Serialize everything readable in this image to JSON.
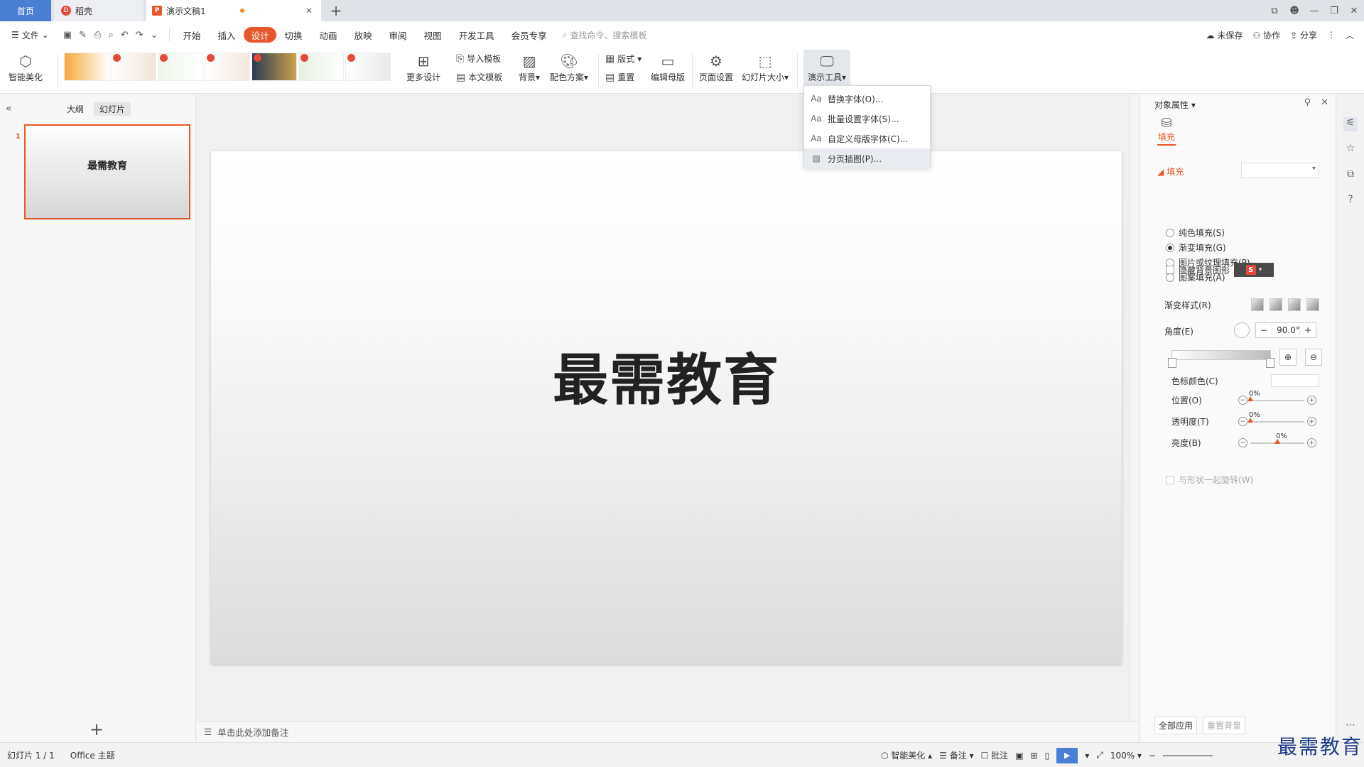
{
  "tabs": {
    "home": "首页",
    "daoke": "稻壳",
    "doc": "演示文稿1"
  },
  "menu": {
    "file": "文件",
    "tabs": [
      "开始",
      "插入",
      "设计",
      "切换",
      "动画",
      "放映",
      "审阅",
      "视图",
      "开发工具",
      "会员专享"
    ],
    "active_tab": "设计",
    "search_placeholder": "查找命令、搜索模板",
    "unsaved": "未保存",
    "collab": "协作",
    "share": "分享"
  },
  "ribbon": {
    "smart_beautify": "智能美化",
    "more_design": "更多设计",
    "import_template": "导入模板",
    "this_template": "本文模板",
    "background": "背景",
    "color_scheme": "配色方案",
    "layout": "版式",
    "reset": "重置",
    "edit_master": "编辑母版",
    "page_setup": "页面设置",
    "slide_size": "幻灯片大小",
    "presentation_tools": "演示工具"
  },
  "dropdown": {
    "items": [
      "替换字体(O)...",
      "批量设置字体(S)...",
      "自定义母版字体(C)...",
      "分页插图(P)..."
    ],
    "hovered_index": 3
  },
  "left_panel": {
    "outline_tab": "大纲",
    "slides_tab": "幻灯片",
    "slide_number": "1",
    "thumb_title": "最需教育"
  },
  "slide": {
    "title": "最需教育"
  },
  "notes": {
    "placeholder": "单击此处添加备注"
  },
  "right_panel": {
    "title": "对象属性",
    "fill_tab": "填充",
    "section": "填充",
    "options": [
      "纯色填充(S)",
      "渐变填充(G)",
      "图片或纹理填充(P)",
      "图案填充(A)"
    ],
    "selected_option": 1,
    "hide_bg": "隐藏背景图形",
    "grad_style": "渐变样式(R)",
    "angle_label": "角度(E)",
    "angle_value": "90.0°",
    "stop_color": "色标颜色(C)",
    "position": "位置(O)",
    "position_value": "0%",
    "transparency": "透明度(T)",
    "transparency_value": "0%",
    "brightness": "亮度(B)",
    "brightness_value": "0%",
    "rotate_with_shape": "与形状一起旋转(W)",
    "apply_all": "全部应用",
    "reset_bg": "重置背景"
  },
  "status": {
    "slide_count": "幻灯片 1 / 1",
    "theme": "Office 主题",
    "smart_beautify": "智能美化",
    "notes": "备注",
    "comments": "批注",
    "zoom": "100%"
  },
  "watermark": "最需教育",
  "colors": {
    "accent": "#e8572c",
    "home_tab": "#4a7fd6",
    "watermark": "#1f3d8a"
  }
}
